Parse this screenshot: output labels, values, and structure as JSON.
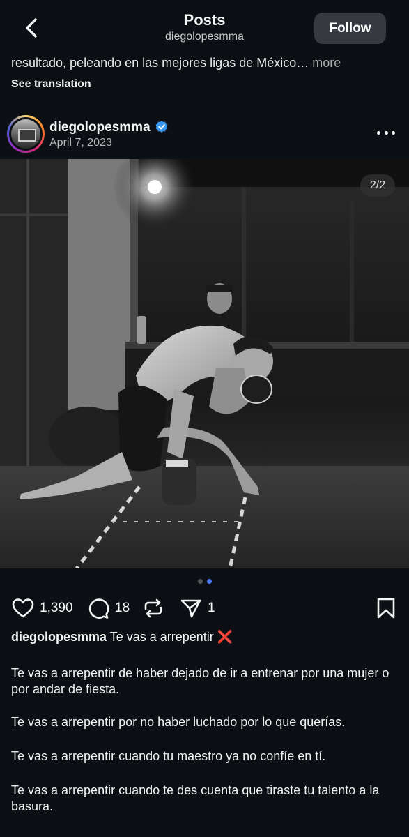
{
  "header": {
    "title": "Posts",
    "subtitle": "diegolopesmma",
    "follow_label": "Follow"
  },
  "previous_post": {
    "caption_tail": "resultado, peleando en las mejores ligas de México…",
    "more_label": "more",
    "see_translation": "See translation"
  },
  "post": {
    "username": "diegolopesmma",
    "date": "April 7, 2023",
    "image_counter": "2/2",
    "carousel": {
      "count": 2,
      "active_index": 1
    },
    "likes": "1,390",
    "comments": "18",
    "shares": "1",
    "caption_first": "Te vas a arrepentir",
    "caption_emoji": "❌",
    "caption_paragraphs": [
      "Te vas a arrepentir de haber dejado de ir a entrenar por una mujer o por andar de fiesta.",
      "Te vas a arrepentir por no haber luchado por lo que querías.",
      "Te vas a arrepentir cuando tu maestro ya no confíe en tí.",
      "Te vas a arrepentir cuando te des cuenta que tiraste tu talento a la basura."
    ]
  },
  "icons": {
    "back": "chevron-left-icon",
    "verified": "verified-badge-icon",
    "more": "more-horizontal-icon",
    "like": "heart-icon",
    "comment": "comment-icon",
    "repost": "repost-icon",
    "share": "send-icon",
    "save": "bookmark-icon"
  },
  "colors": {
    "background": "#0c1014",
    "follow_button": "#363a40",
    "verified_blue": "#3897f0",
    "active_dot": "#4b7cf3"
  }
}
